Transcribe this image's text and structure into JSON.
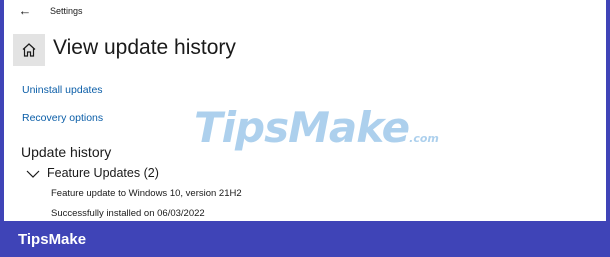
{
  "window": {
    "app_title": "Settings",
    "page_title": "View update history"
  },
  "links": {
    "uninstall": "Uninstall updates",
    "recovery": "Recovery options"
  },
  "history": {
    "heading": "Update history",
    "groups": [
      {
        "label": "Feature Updates (2)",
        "expanded": true,
        "items": [
          {
            "title": "Feature update to Windows 10, version 21H2",
            "status": "Successfully installed on 06/03/2022"
          }
        ]
      }
    ]
  },
  "watermark": {
    "main": "TipsMake",
    "suffix": ".com"
  },
  "footer": {
    "brand": "TipsMake"
  },
  "icons": {
    "back": "back-arrow-icon",
    "home": "home-icon",
    "expand": "chevron-down-icon"
  },
  "colors": {
    "accent": "#3f44b7",
    "link": "#0b5ea8",
    "home_button_bg": "#e3e3e3",
    "watermark": "#2a86d0"
  }
}
